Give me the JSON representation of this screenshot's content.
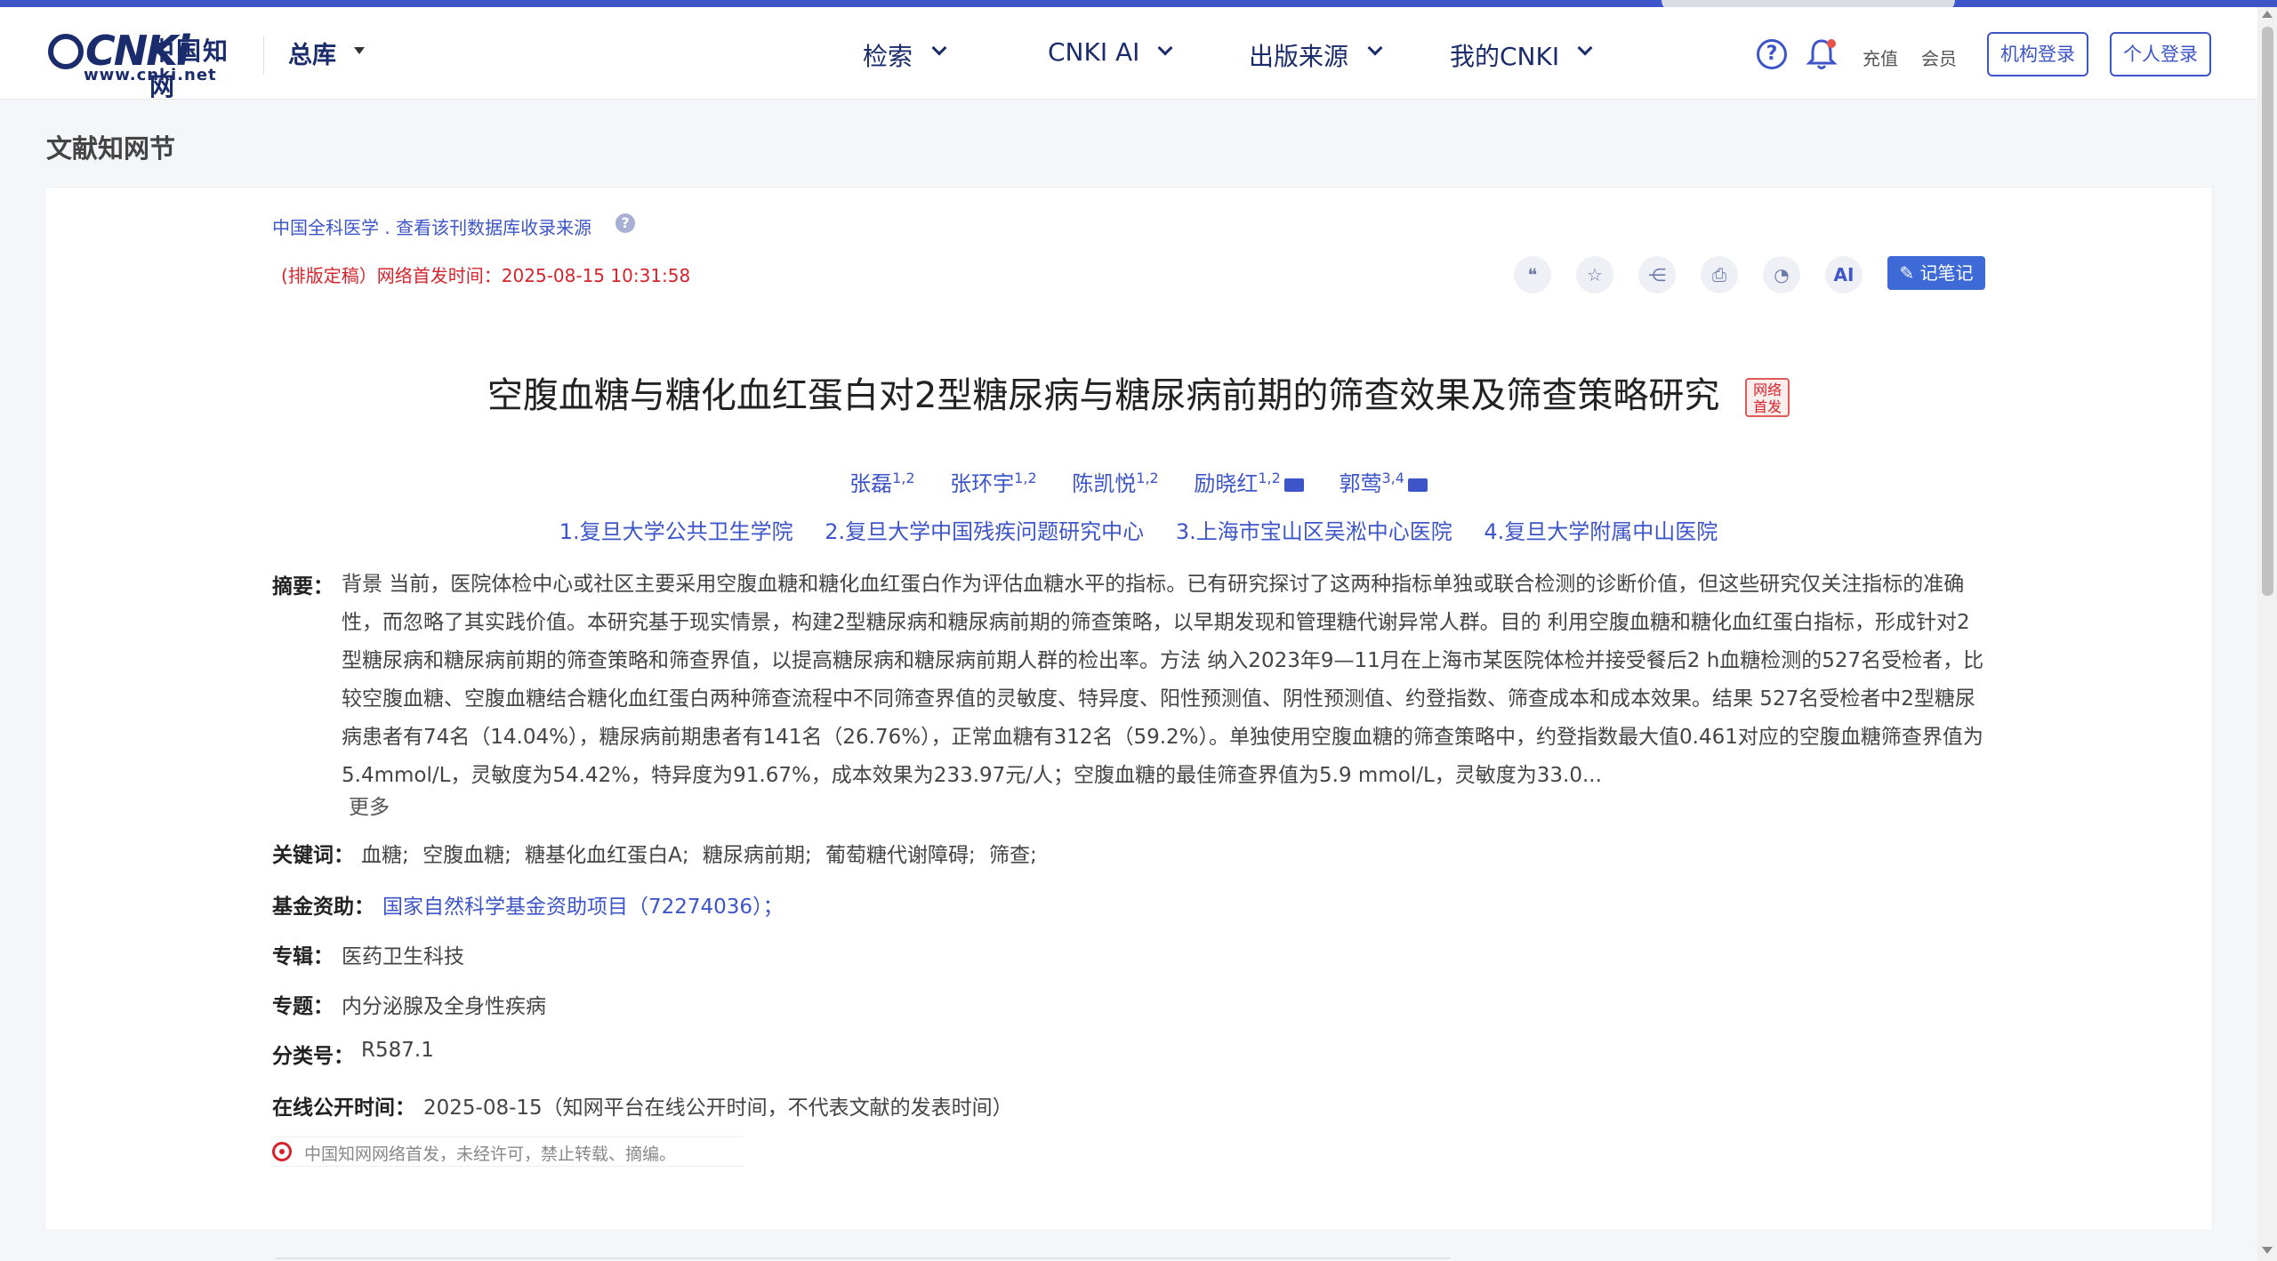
{
  "header": {
    "logo_text": "CNKi",
    "logo_cn": "中国知网",
    "logo_url": "www.cnki.net",
    "library": "总库",
    "nav": [
      "检索",
      "CNKI AI",
      "出版来源",
      "我的CNKI"
    ],
    "recharge": "充值",
    "member": "会员",
    "inst_login": "机构登录",
    "personal_login": "个人登录"
  },
  "section_title": "文献知网节",
  "paper": {
    "source": "中国全科医学 .    查看该刊数据库收录来源",
    "pub_time": "(排版定稿）网络首发时间：2025-08-15 10:31:58",
    "title": "空腹血糖与糖化血红蛋白对2型糖尿病与糖尿病前期的筛查效果及筛查策略研究",
    "badge": "网络首发",
    "authors": [
      {
        "name": "张磊",
        "sup": "1,2",
        "mail": false
      },
      {
        "name": "张环宇",
        "sup": "1,2",
        "mail": false
      },
      {
        "name": "陈凯悦",
        "sup": "1,2",
        "mail": false
      },
      {
        "name": "励晓红",
        "sup": "1,2",
        "mail": true
      },
      {
        "name": "郭莺",
        "sup": "3,4",
        "mail": true
      }
    ],
    "affiliations": [
      "1.复旦大学公共卫生学院",
      "2.复旦大学中国残疾问题研究中心",
      "3.上海市宝山区吴淞中心医院",
      "4.复旦大学附属中山医院"
    ],
    "note_button": "记笔记",
    "ai_label": "AI",
    "abstract_label": "摘要：",
    "abstract": "背景 当前，医院体检中心或社区主要采用空腹血糖和糖化血红蛋白作为评估血糖水平的指标。已有研究探讨了这两种指标单独或联合检测的诊断价值，但这些研究仅关注指标的准确性，而忽略了其实践价值。本研究基于现实情景，构建2型糖尿病和糖尿病前期的筛查策略，以早期发现和管理糖代谢异常人群。目的 利用空腹血糖和糖化血红蛋白指标，形成针对2型糖尿病和糖尿病前期的筛查策略和筛查界值，以提高糖尿病和糖尿病前期人群的检出率。方法 纳入2023年9—11月在上海市某医院体检并接受餐后2 h血糖检测的527名受检者，比较空腹血糖、空腹血糖结合糖化血红蛋白两种筛查流程中不同筛查界值的灵敏度、特异度、阳性预测值、阴性预测值、约登指数、筛查成本和成本效果。结果 527名受检者中2型糖尿病患者有74名（14.04%），糖尿病前期患者有141名（26.76%），正常血糖有312名（59.2%）。单独使用空腹血糖的筛查策略中，约登指数最大值0.461对应的空腹血糖筛查界值为5.4mmol/L，灵敏度为54.42%，特异度为91.67%，成本效果为233.97元/人；空腹血糖的最佳筛查界值为5.9 mmol/L，灵敏度为33.0...",
    "more": "更多",
    "keywords_label": "关键词：",
    "keywords": [
      "血糖;",
      "空腹血糖;",
      "糖基化血红蛋白A;",
      "糖尿病前期;",
      "葡萄糖代谢障碍;",
      "筛查;"
    ],
    "fund_label": "基金资助：",
    "fund": "国家自然科学基金资助项目（72274036）；",
    "series_label": "专辑：",
    "series": "医药卫生科技",
    "topic_label": "专题：",
    "topic": "内分泌腺及全身性疾病",
    "class_label": "分类号：",
    "class_no": "R587.1",
    "online_label": "在线公开时间：",
    "online_time": "2025-08-15（知网平台在线公开时间，不代表文献的发表时间）",
    "copyright": "中国知网网络首发，未经许可，禁止转载、摘编。"
  },
  "colors": {
    "accent": "#3d55c8",
    "red": "#d6242c",
    "brand": "#1a2c6b"
  }
}
